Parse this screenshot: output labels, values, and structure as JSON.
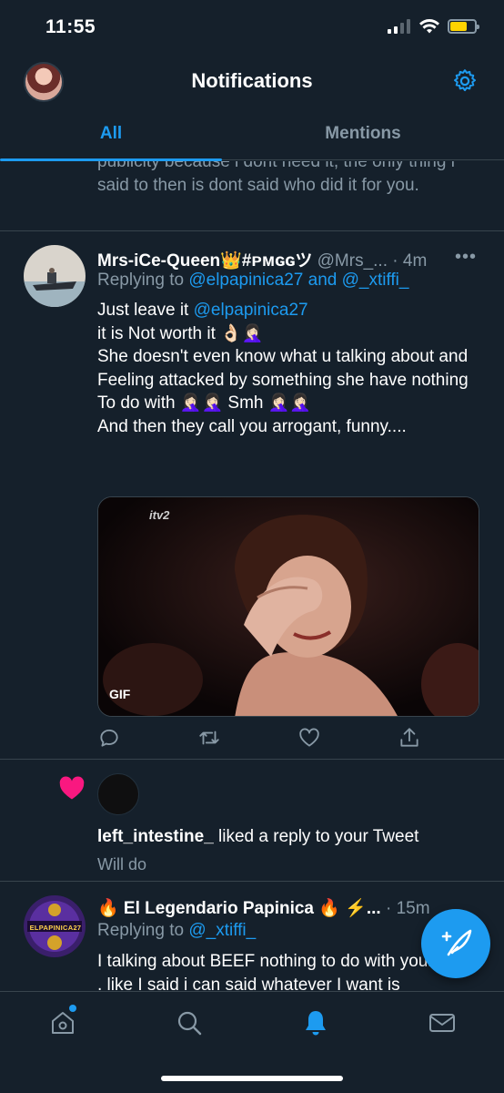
{
  "status_bar": {
    "time": "11:55"
  },
  "header": {
    "title": "Notifications"
  },
  "tabs": [
    {
      "label": "All"
    },
    {
      "label": "Mentions"
    }
  ],
  "feed": {
    "previous_tweet_tail": "publicity because i dont need it, the only thing i said to then is dont said who did it for you.",
    "tweet1": {
      "name": "Mrs-iCe-Queen👑#ᴘᴍɢɢツ",
      "handle": "@Mrs_...",
      "time": "· 4m",
      "replying_prefix": "Replying to ",
      "replying_to_1": "@elpapinica27",
      "replying_joiner": " and ",
      "replying_to_2": "@_xtiffi_",
      "line1_text": "Just leave it ",
      "line1_mention": "@elpapinica27",
      "body_rest": "it is Not worth it 👌🏻🤦🏻‍♀️\nShe doesn't even know what u talking about and Feeling attacked by something she have nothing To do with 🤦🏻‍♀️🤦🏻‍♀️ Smh 🤦🏻‍♀️🤦🏻‍♀️\nAnd then they call you arrogant, funny....",
      "media_badge": "GIF",
      "media_logo": "itv2"
    },
    "like_notification": {
      "user": "left_intestine_",
      "action": " liked a reply to your Tweet",
      "reply_text": "Will do"
    },
    "tweet2": {
      "name": "🔥 El Legendario Papinica 🔥 ⚡...",
      "time": "· 15m",
      "replying_prefix": "Replying to ",
      "replying_to": "@_xtiffi_",
      "body": "I talking about BEEF nothing to do with your thing , like I said i can said whatever I want is",
      "avatar_text": "ELPAPINICA27"
    }
  },
  "colors": {
    "background": "#15202b",
    "accent": "#1d9bf0",
    "secondary_text": "#8899a6",
    "like_red": "#f91880",
    "battery": "#ffd400"
  },
  "icons": [
    "gear-icon",
    "reply-icon",
    "retweet-icon",
    "like-icon",
    "share-icon",
    "heart-icon",
    "compose-icon",
    "home-icon",
    "search-icon",
    "bell-icon",
    "mail-icon"
  ]
}
